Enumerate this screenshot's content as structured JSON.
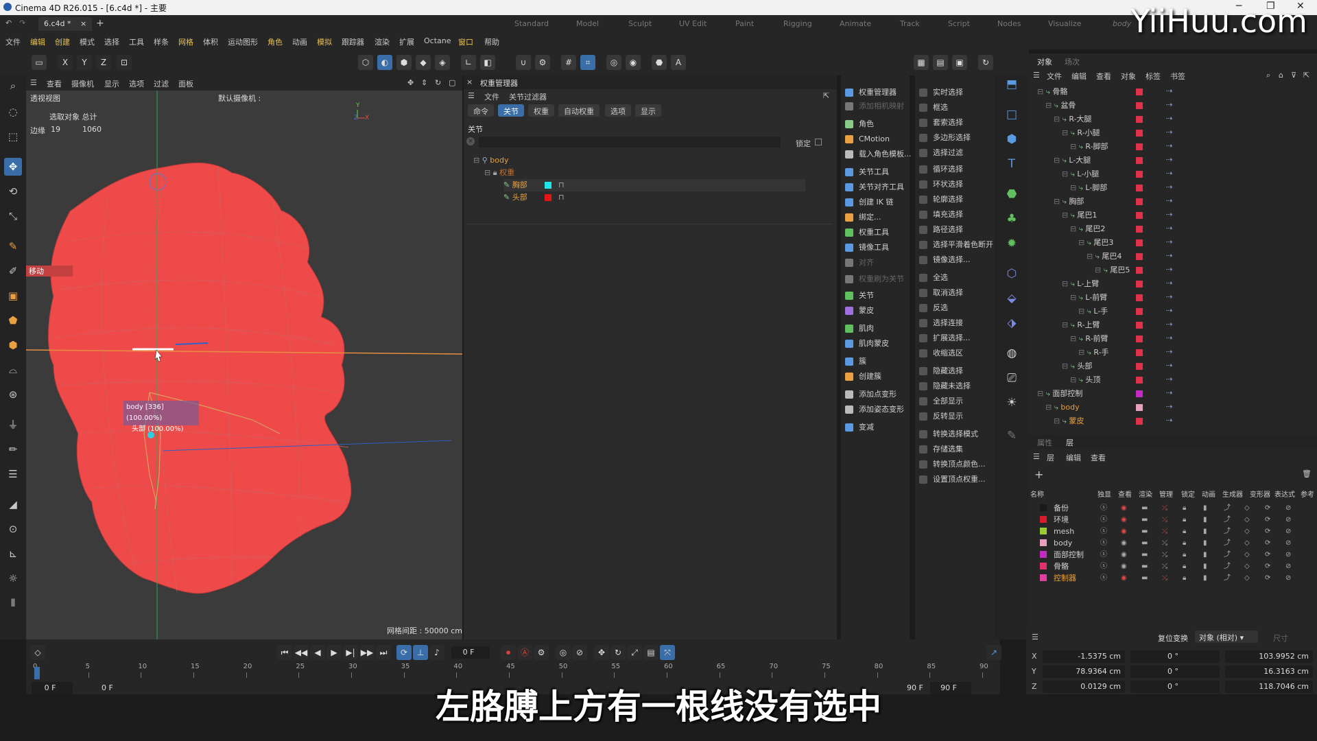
{
  "app": {
    "title": "Cinema 4D R26.015 - [6.c4d *] - 主要",
    "doc_tab": "6.c4d *",
    "layouts": [
      "Standard",
      "Model",
      "Sculpt",
      "UV Edit",
      "Paint",
      "Rigging",
      "Animate",
      "Track",
      "Script",
      "Nodes",
      "Visualize",
      "body"
    ]
  },
  "menubar": [
    "文件",
    "编辑",
    "创建",
    "模式",
    "选择",
    "工具",
    "样条",
    "网格",
    "体积",
    "运动图形",
    "角色",
    "动画",
    "模拟",
    "跟踪器",
    "渲染",
    "扩展",
    "Octane",
    "窗口",
    "帮助"
  ],
  "viewport": {
    "menu": [
      "查看",
      "摄像机",
      "显示",
      "选项",
      "过滤",
      "面板"
    ],
    "name": "透视视图",
    "camera": "默认摄像机 :",
    "stats_header": "选取对象 总计",
    "stats_label": "边缘",
    "stats_selected": "19",
    "stats_total": "1060",
    "mode_label": "移动",
    "tooltip_line1": "body [336] (100.00%)",
    "tooltip_line2": "头部 (100.00%)",
    "grid_spacing": "网格间距 : 50000 cm",
    "axis_x": "X",
    "axis_y": "Y",
    "axis_z": "Z"
  },
  "weight_manager": {
    "title": "权重管理器",
    "menu": [
      "文件",
      "关节过滤器"
    ],
    "tabs": [
      "命令",
      "关节",
      "权重",
      "自动权重",
      "选项",
      "显示"
    ],
    "active_tab": "关节",
    "section": "关节",
    "lock_label": "锁定",
    "tree": {
      "root": "body",
      "group": "权重",
      "joints": [
        {
          "name": "胸部",
          "color": "#1ee6e6"
        },
        {
          "name": "头部",
          "color": "#e51616"
        }
      ]
    }
  },
  "char_commands": {
    "col1": [
      "权重管理器",
      "添加相机映射",
      "角色",
      "CMotion",
      "载入角色模板...",
      "关节工具",
      "关节对齐工具",
      "创建 IK 链",
      "绑定...",
      "权重工具",
      "镜像工具",
      "对齐",
      "权重刷为关节",
      "关节",
      "蒙皮",
      "肌肉",
      "肌肉蒙皮",
      "簇",
      "创建簇",
      "添加点变形",
      "添加姿态变形",
      "变减"
    ],
    "col2": [
      "实时选择",
      "框选",
      "套索选择",
      "多边形选择",
      "选择过滤",
      "循环选择",
      "环状选择",
      "轮廓选择",
      "填充选择",
      "路径选择",
      "选择平滑着色断开",
      "镜像选择...",
      "全选",
      "取消选择",
      "反选",
      "选择连接",
      "扩展选择...",
      "收缩选区",
      "隐藏选择",
      "隐藏未选择",
      "全部显示",
      "反转显示",
      "转换选择模式",
      "存储选集",
      "转换顶点颜色...",
      "设置顶点权重..."
    ]
  },
  "object_panel": {
    "tabs": [
      "对象",
      "场次"
    ],
    "menu": [
      "文件",
      "编辑",
      "查看",
      "对象",
      "标签",
      "书签"
    ],
    "tree": [
      {
        "name": "骨骼",
        "level": 0
      },
      {
        "name": "盆骨",
        "level": 1
      },
      {
        "name": "R-大腿",
        "level": 2
      },
      {
        "name": "R-小腿",
        "level": 3
      },
      {
        "name": "R-脚部",
        "level": 4
      },
      {
        "name": "L-大腿",
        "level": 2
      },
      {
        "name": "L-小腿",
        "level": 3
      },
      {
        "name": "L-脚部",
        "level": 4
      },
      {
        "name": "胸部",
        "level": 2
      },
      {
        "name": "尾巴1",
        "level": 3
      },
      {
        "name": "尾巴2",
        "level": 4
      },
      {
        "name": "尾巴3",
        "level": 5
      },
      {
        "name": "尾巴4",
        "level": 6
      },
      {
        "name": "尾巴5",
        "level": 7
      },
      {
        "name": "L-上臂",
        "level": 3
      },
      {
        "name": "L-前臂",
        "level": 4
      },
      {
        "name": "L-手",
        "level": 5
      },
      {
        "name": "R-上臂",
        "level": 3
      },
      {
        "name": "R-前臂",
        "level": 4
      },
      {
        "name": "R-手",
        "level": 5
      },
      {
        "name": "头部",
        "level": 3
      },
      {
        "name": "头顶",
        "level": 4
      },
      {
        "name": "面部控制",
        "level": 0
      },
      {
        "name": "body",
        "level": 1
      },
      {
        "name": "蒙皮",
        "level": 2
      }
    ]
  },
  "layer_panel": {
    "tabs": [
      "属性",
      "层"
    ],
    "menu": [
      "层",
      "编辑",
      "查看"
    ],
    "columns": [
      "名称",
      "独显",
      "查看",
      "渲染",
      "管理",
      "锁定",
      "动画",
      "生成器",
      "变形器",
      "表达式",
      "参考"
    ],
    "layers": [
      {
        "name": "备份",
        "color": "#1a1a1a"
      },
      {
        "name": "环境",
        "color": "#d81c2c"
      },
      {
        "name": "mesh",
        "color": "#9acd32"
      },
      {
        "name": "body",
        "color": "#e8a0c0"
      },
      {
        "name": "面部控制",
        "color": "#c42ac4"
      },
      {
        "name": "骨骼",
        "color": "#e03070"
      },
      {
        "name": "控制器",
        "color": "#e040a0"
      }
    ]
  },
  "coordinates": {
    "reset_label": "复位变换",
    "mode_label": "对象 (相对)",
    "size_label": "尺寸",
    "rows": [
      {
        "axis": "X",
        "pos": "-1.5375 cm",
        "rot": "0 °",
        "size": "103.9952 cm"
      },
      {
        "axis": "Y",
        "pos": "78.9364 cm",
        "rot": "0 °",
        "size": "16.3163 cm"
      },
      {
        "axis": "Z",
        "pos": "0.0129 cm",
        "rot": "0 °",
        "size": "118.7046 cm"
      }
    ]
  },
  "timeline": {
    "current_frame": "0 F",
    "start": "0 F",
    "start2": "0 F",
    "end": "90 F",
    "end2": "90 F",
    "ticks": [
      "0",
      "5",
      "10",
      "15",
      "20",
      "25",
      "30",
      "35",
      "40",
      "45",
      "50",
      "55",
      "60",
      "65",
      "70",
      "75",
      "80",
      "85",
      "90"
    ]
  },
  "subtitle": "左胳膊上方有一根线没有选中",
  "watermark": "YiiHuu.com"
}
